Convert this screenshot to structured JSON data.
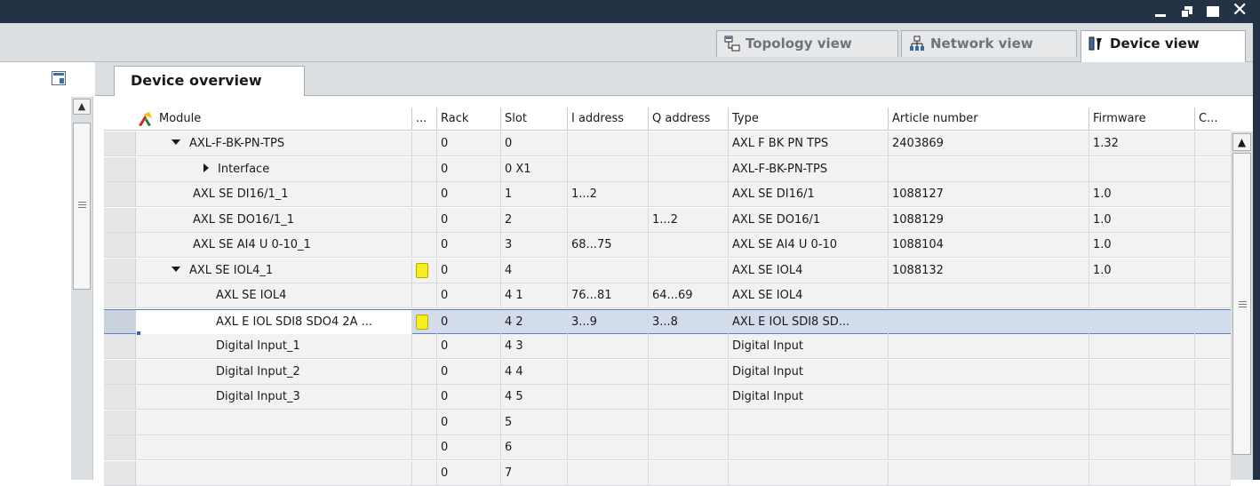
{
  "window": {
    "controls": {
      "minimize": "minimize",
      "restore": "restore",
      "maximize": "maximize",
      "close": "✕"
    }
  },
  "views": [
    {
      "label": "Topology view",
      "icon": "topology-icon",
      "active": false
    },
    {
      "label": "Network view",
      "icon": "network-icon",
      "active": false
    },
    {
      "label": "Device view",
      "icon": "device-icon",
      "active": true
    }
  ],
  "editor": {
    "tab_label": "Device overview"
  },
  "table": {
    "columns": [
      "Module",
      "...",
      "Rack",
      "Slot",
      "I address",
      "Q address",
      "Type",
      "Article number",
      "Firmware",
      "C..."
    ],
    "rows": [
      {
        "module": "AXL-F-BK-PN-TPS",
        "expander": "expanded",
        "marker": false,
        "rack": "0",
        "slot": "0",
        "i": "",
        "q": "",
        "type": "AXL F BK PN TPS",
        "article": "2403869",
        "firmware": "1.32"
      },
      {
        "module": "Interface",
        "expander": "collapsed",
        "marker": false,
        "rack": "0",
        "slot": "0 X1",
        "i": "",
        "q": "",
        "type": "AXL-F-BK-PN-TPS",
        "article": "",
        "firmware": ""
      },
      {
        "module": "AXL SE DI16/1_1",
        "expander": "",
        "marker": false,
        "rack": "0",
        "slot": "1",
        "i": "1...2",
        "q": "",
        "type": "AXL SE DI16/1",
        "article": "1088127",
        "firmware": "1.0"
      },
      {
        "module": "AXL SE DO16/1_1",
        "expander": "",
        "marker": false,
        "rack": "0",
        "slot": "2",
        "i": "",
        "q": "1...2",
        "type": "AXL SE DO16/1",
        "article": "1088129",
        "firmware": "1.0"
      },
      {
        "module": "AXL SE AI4 U 0-10_1",
        "expander": "",
        "marker": false,
        "rack": "0",
        "slot": "3",
        "i": "68...75",
        "q": "",
        "type": "AXL SE AI4 U 0-10",
        "article": "1088104",
        "firmware": "1.0"
      },
      {
        "module": "AXL SE IOL4_1",
        "expander": "expanded",
        "marker": true,
        "rack": "0",
        "slot": "4",
        "i": "",
        "q": "",
        "type": "AXL SE IOL4",
        "article": "1088132",
        "firmware": "1.0"
      },
      {
        "module": "AXL SE IOL4",
        "expander": "",
        "marker": false,
        "rack": "0",
        "slot": "4 1",
        "i": "76...81",
        "q": "64...69",
        "type": "AXL SE IOL4",
        "article": "",
        "firmware": ""
      },
      {
        "module": "AXL E IOL SDI8 SDO4 2A ...",
        "expander": "",
        "marker": true,
        "rack": "0",
        "slot": "4 2",
        "i": "3...9",
        "q": "3...8",
        "type": "AXL E IOL SDI8 SD...",
        "article": "",
        "firmware": "",
        "selected": true
      },
      {
        "module": "Digital Input_1",
        "expander": "",
        "marker": false,
        "rack": "0",
        "slot": "4 3",
        "i": "",
        "q": "",
        "type": "Digital Input",
        "article": "",
        "firmware": ""
      },
      {
        "module": "Digital Input_2",
        "expander": "",
        "marker": false,
        "rack": "0",
        "slot": "4 4",
        "i": "",
        "q": "",
        "type": "Digital Input",
        "article": "",
        "firmware": ""
      },
      {
        "module": "Digital Input_3",
        "expander": "",
        "marker": false,
        "rack": "0",
        "slot": "4 5",
        "i": "",
        "q": "",
        "type": "Digital Input",
        "article": "",
        "firmware": ""
      },
      {
        "module": "",
        "expander": "",
        "marker": false,
        "rack": "0",
        "slot": "5",
        "i": "",
        "q": "",
        "type": "",
        "article": "",
        "firmware": ""
      },
      {
        "module": "",
        "expander": "",
        "marker": false,
        "rack": "0",
        "slot": "6",
        "i": "",
        "q": "",
        "type": "",
        "article": "",
        "firmware": ""
      },
      {
        "module": "",
        "expander": "",
        "marker": false,
        "rack": "0",
        "slot": "7",
        "i": "",
        "q": "",
        "type": "",
        "article": "",
        "firmware": ""
      }
    ]
  },
  "colors": {
    "titlebar": "#233245",
    "selection": "#d3dceb",
    "marker": "#f6ef1f"
  }
}
